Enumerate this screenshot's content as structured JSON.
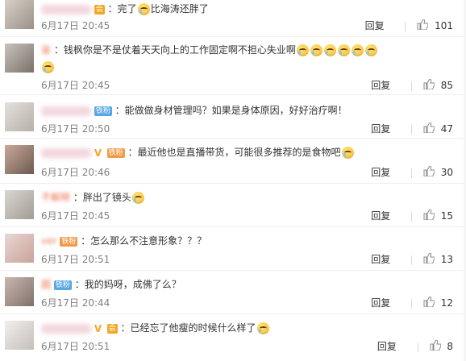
{
  "comments": [
    {
      "name": "",
      "badges": [
        "vip"
      ],
      "text_before": "：完了",
      "emojis_before": 1,
      "text_after": "比海涛还胖了",
      "emojis_after": 0,
      "time": "6月17日 20:45",
      "reply": "回复",
      "likes": "101"
    },
    {
      "name": "宙",
      "badges": [],
      "text_before": "：钱枫你是不是仗着天天向上的工作固定啊不担心失业啊",
      "emojis_before": 0,
      "text_after": "",
      "emojis_after": 7,
      "time": "6月17日 20:45",
      "reply": "回复",
      "likes": "85"
    },
    {
      "name": "",
      "badges": [
        "fan_blue"
      ],
      "fan_label": "铁粉",
      "text_before": "：能做做身材管理吗？如果是身体原因，好好治疗啊！",
      "emojis_before": 0,
      "text_after": "",
      "emojis_after": 0,
      "time": "6月17日 20:50",
      "reply": "回复",
      "likes": "47"
    },
    {
      "name": "",
      "badges": [
        "v",
        "fan_gold"
      ],
      "fan_label": "铁粉",
      "text_before": "：最近他也是直播带货，可能很多推荐的是食物吧",
      "emojis_before": 0,
      "text_after": "",
      "emojis_after": 1,
      "time": "6月17日 20:46",
      "reply": "回复",
      "likes": "30"
    },
    {
      "name": "不解释",
      "badges": [],
      "text_before": "：胖出了镜头",
      "emojis_before": 0,
      "text_after": "",
      "emojis_after": 1,
      "time": "6月17日 20:45",
      "reply": "回复",
      "likes": "15"
    },
    {
      "name": "ver",
      "badges": [
        "fan_gold"
      ],
      "fan_label": "铁粉",
      "text_before": "：怎么那么不注意形象？？？",
      "emojis_before": 0,
      "text_after": "",
      "emojis_after": 0,
      "time": "6月17日 20:51",
      "reply": "回复",
      "likes": "13"
    },
    {
      "name": "圆",
      "badges": [
        "fan_blue"
      ],
      "fan_label": "铁粉",
      "text_before": "：我的妈呀，成佛了么？",
      "emojis_before": 0,
      "text_after": "",
      "emojis_after": 0,
      "time": "6月17日 20:44",
      "reply": "回复",
      "likes": "12"
    },
    {
      "name": "",
      "badges": [
        "v",
        "vip"
      ],
      "text_before": "：已经忘了他瘦的时候什么样了",
      "emojis_before": 0,
      "text_after": "",
      "emojis_after": 1,
      "time": "6月17日 20:51",
      "reply": "回复",
      "likes": "8"
    }
  ],
  "colors": {
    "name": "#eb7350",
    "meta": "#808080",
    "badge_vip": "#f6a623",
    "badge_fan_blue": "#58a7e4",
    "badge_fan_gold": "#f29a4a"
  },
  "icons": {
    "like": "thumbs-up-icon",
    "emoji": "tears-of-joy-emoji-icon",
    "verified": "verified-v-icon"
  }
}
